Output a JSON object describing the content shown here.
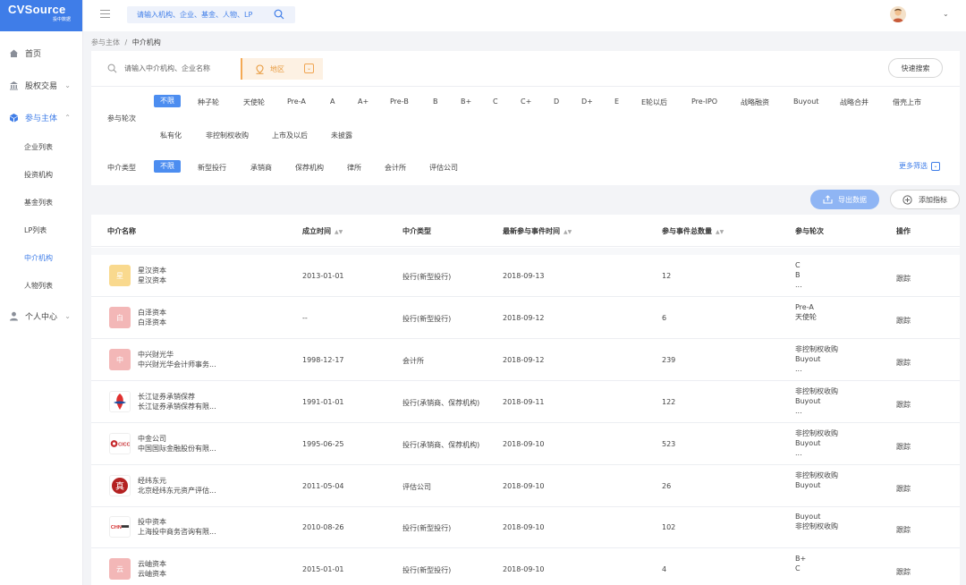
{
  "brand": {
    "name": "CVSource",
    "sub": "投中数据"
  },
  "nav": [
    {
      "label": "首页",
      "icon": "home-icon"
    },
    {
      "label": "股权交易",
      "icon": "bank-icon"
    },
    {
      "label": "参与主体",
      "icon": "cube-icon"
    },
    {
      "label": "个人中心",
      "icon": "user-icon"
    }
  ],
  "nav_sub": [
    "企业列表",
    "投资机构",
    "基金列表",
    "LP列表",
    "中介机构",
    "人物列表"
  ],
  "header": {
    "search_placeholder": "请输入机构、企业、基金、人物、LP"
  },
  "breadcrumb": {
    "parent": "参与主体",
    "sep": "/",
    "current": "中介机构"
  },
  "filters": {
    "search_placeholder": "请输入中介机构、企业名称",
    "region_label": "地区",
    "quick_search": "快速搜索",
    "round_label": "参与轮次",
    "rounds_row1": [
      "不限",
      "种子轮",
      "天使轮",
      "Pre-A",
      "A",
      "A+",
      "Pre-B",
      "B",
      "B+",
      "C",
      "C+",
      "D",
      "D+",
      "E",
      "E轮以后",
      "Pre-IPO",
      "战略融资",
      "Buyout",
      "战略合并",
      "借壳上市"
    ],
    "rounds_row2": [
      "私有化",
      "非控制权收购",
      "上市及以后",
      "未披露"
    ],
    "type_label": "中介类型",
    "types": [
      "不限",
      "新型投行",
      "承销商",
      "保荐机构",
      "律所",
      "会计所",
      "评估公司"
    ],
    "more": "更多筛选"
  },
  "actions": {
    "export": "导出数据",
    "add_index": "添加指标"
  },
  "table": {
    "headers": [
      "中介名称",
      "成立时间",
      "中介类型",
      "最新参与事件时间",
      "参与事件总数量",
      "参与轮次",
      "操作"
    ],
    "rows": [
      {
        "name": "星汉资本",
        "full": "星汉资本",
        "logo_char": "星",
        "logo_color": "#f9d98e",
        "founded": "2013-01-01",
        "type": "投行(新型投行)",
        "latest": "2018-09-13",
        "count": "12",
        "rounds": [
          "C",
          "B",
          "..."
        ],
        "op": "跟踪"
      },
      {
        "name": "白泽资本",
        "full": "白泽资本",
        "logo_char": "白",
        "logo_color": "#f3b7b7",
        "founded": "--",
        "type": "投行(新型投行)",
        "latest": "2018-09-12",
        "count": "6",
        "rounds": [
          "Pre-A",
          "天使轮"
        ],
        "op": "跟踪"
      },
      {
        "name": "中兴财光华",
        "full": "中兴财光华会计师事务...",
        "logo_char": "中",
        "logo_color": "#f3b7b7",
        "founded": "1998-12-17",
        "type": "会计所",
        "latest": "2018-09-12",
        "count": "239",
        "rounds": [
          "非控制权收购",
          "Buyout",
          "..."
        ],
        "op": "跟踪"
      },
      {
        "name": "长江证券承销保荐",
        "full": "长江证券承销保荐有限...",
        "logo_char": "",
        "logo_color": "#ffffff",
        "founded": "1991-01-01",
        "type": "投行(承销商、保荐机构)",
        "latest": "2018-09-11",
        "count": "122",
        "rounds": [
          "非控制权收购",
          "Buyout",
          "..."
        ],
        "op": "跟踪"
      },
      {
        "name": "中金公司",
        "full": "中国国际金融股份有限...",
        "logo_char": "CICC",
        "logo_color": "#ffffff",
        "founded": "1995-06-25",
        "type": "投行(承销商、保荐机构)",
        "latest": "2018-09-10",
        "count": "523",
        "rounds": [
          "非控制权收购",
          "Buyout",
          "..."
        ],
        "op": "跟踪"
      },
      {
        "name": "经纬东元",
        "full": "北京经纬东元资产评估...",
        "logo_char": "真",
        "logo_color": "#ffffff",
        "founded": "2011-05-04",
        "type": "评估公司",
        "latest": "2018-09-10",
        "count": "26",
        "rounds": [
          "非控制权收购",
          "Buyout"
        ],
        "op": "跟踪"
      },
      {
        "name": "投中资本",
        "full": "上海投中商务咨询有限...",
        "logo_char": "CHN",
        "logo_color": "#ffffff",
        "founded": "2010-08-26",
        "type": "投行(新型投行)",
        "latest": "2018-09-10",
        "count": "102",
        "rounds": [
          "Buyout",
          "非控制权收购"
        ],
        "op": "跟踪"
      },
      {
        "name": "云岫资本",
        "full": "云岫资本",
        "logo_char": "云",
        "logo_color": "#f3b7b7",
        "founded": "2015-01-01",
        "type": "投行(新型投行)",
        "latest": "2018-09-10",
        "count": "4",
        "rounds": [
          "B+",
          "C"
        ],
        "op": "跟踪"
      }
    ]
  },
  "colors": {
    "accent": "#3f7de8",
    "sidebar_bg": "#ffffff",
    "page_bg": "#f3f4f7"
  }
}
